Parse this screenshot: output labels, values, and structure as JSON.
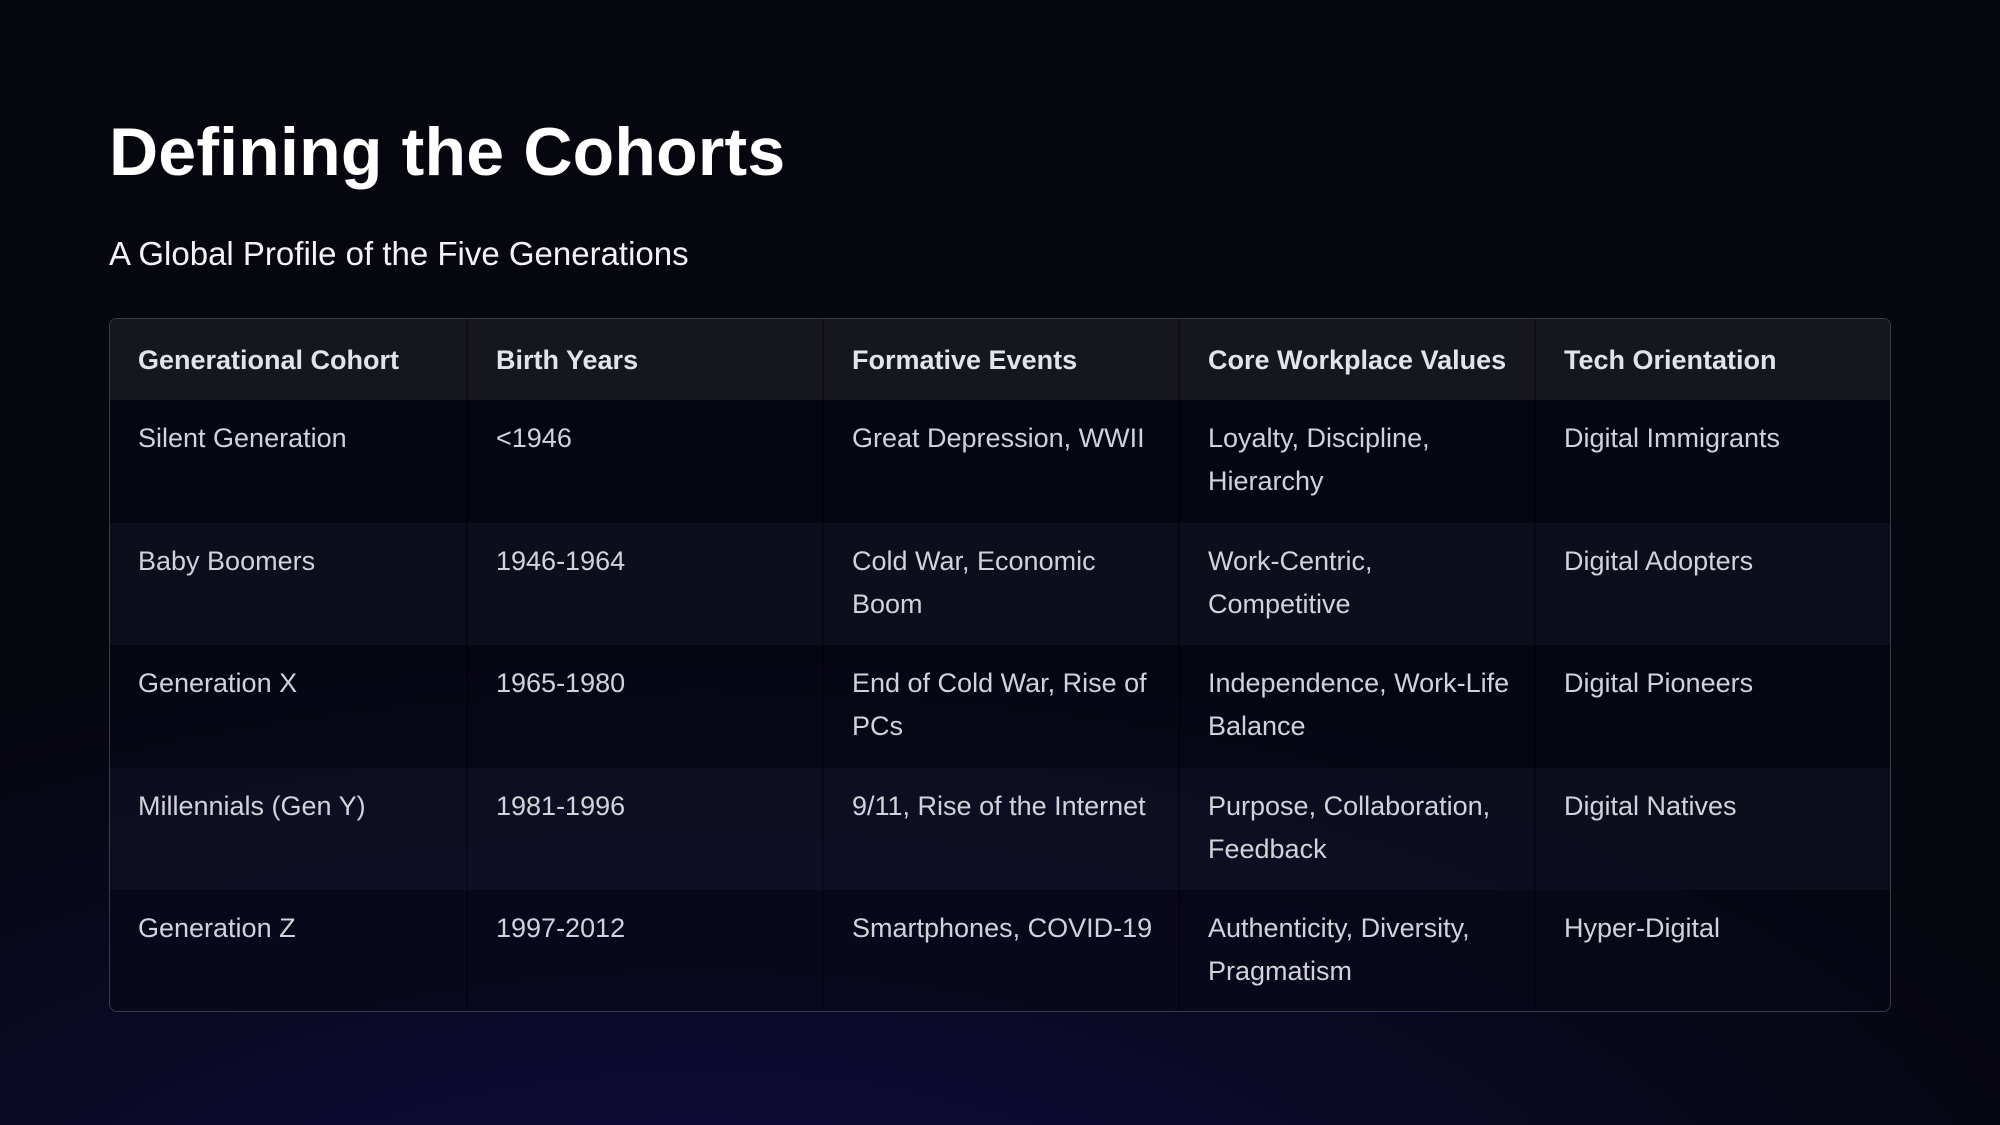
{
  "page": {
    "title": "Defining the Cohorts",
    "subtitle": "A Global Profile of the Five Generations"
  },
  "table": {
    "headers": [
      "Generational Cohort",
      "Birth Years",
      "Formative Events",
      "Core Workplace Values",
      "Tech Orientation"
    ],
    "rows": [
      [
        "Silent Generation",
        "<1946",
        "Great Depression, WWII",
        "Loyalty, Discipline, Hierarchy",
        "Digital Immigrants"
      ],
      [
        "Baby Boomers",
        "1946-1964",
        "Cold War, Economic Boom",
        "Work-Centric, Competitive",
        "Digital Adopters"
      ],
      [
        "Generation X",
        "1965-1980",
        "End of Cold War, Rise of PCs",
        "Independence, Work-Life Balance",
        "Digital Pioneers"
      ],
      [
        "Millennials (Gen Y)",
        "1981-1996",
        "9/11, Rise of the Internet",
        "Purpose, Collaboration, Feedback",
        "Digital Natives"
      ],
      [
        "Generation Z",
        "1997-2012",
        "Smartphones, COVID-19",
        "Authenticity, Diversity, Pragmatism",
        "Hyper-Digital"
      ]
    ]
  },
  "colors": {
    "background": "#07070f",
    "header_row": "#16161f",
    "border": "#3a3a4c",
    "title_text": "#ffffff",
    "body_text": "#d2d2da"
  }
}
